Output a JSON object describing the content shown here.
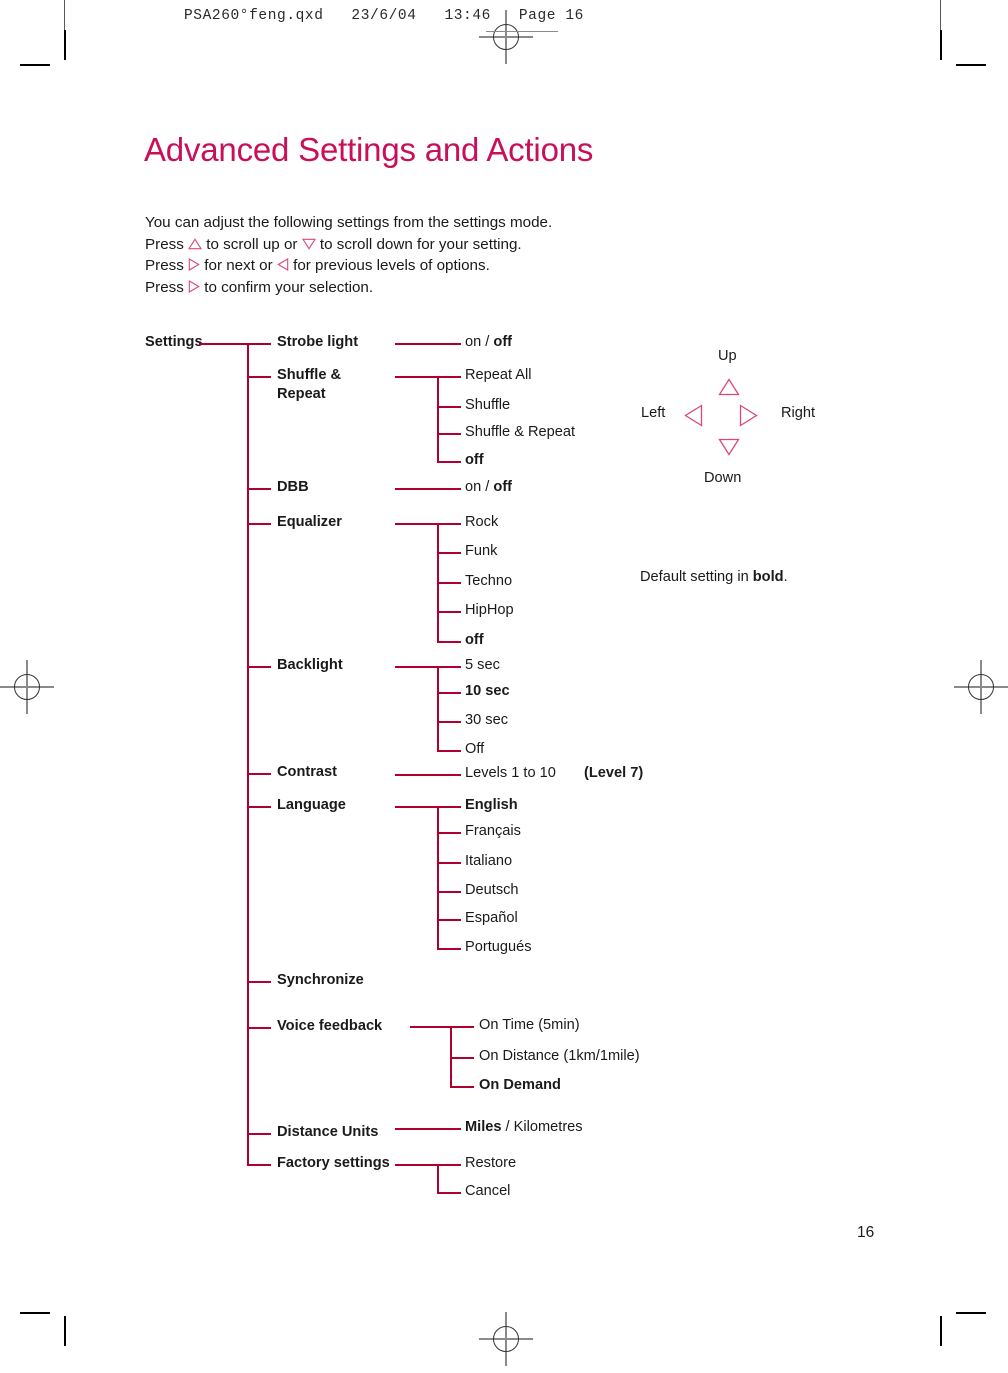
{
  "slug": {
    "text": "PSA260°feng.qxd   23/6/04   13:46   Page 16"
  },
  "page": {
    "title": "Advanced Settings and Actions",
    "number": "16",
    "accent_title_color": "#C8105A",
    "accent_line_color": "#B00030"
  },
  "intro": {
    "line1": "You can adjust the following settings from the settings mode.",
    "line2_a": "Press ",
    "line2_b": " to scroll up or ",
    "line2_c": " to scroll down for your setting.",
    "line3_a": "Press ",
    "line3_b": " for next or ",
    "line3_c": " for previous levels of options.",
    "line4_a": "Press ",
    "line4_b": " to confirm your selection."
  },
  "tree": {
    "root": "Settings",
    "branches": [
      {
        "label": "Strobe light",
        "bold": true,
        "options": [
          {
            "text": "on / ",
            "bold": false,
            "suffix": "off",
            "suffix_bold": true
          }
        ]
      },
      {
        "label": "Shuffle &",
        "label2": "Repeat",
        "bold": true,
        "options": [
          {
            "text": "Repeat All",
            "bold": false
          },
          {
            "text": "Shuffle",
            "bold": false
          },
          {
            "text": "Shuffle & Repeat",
            "bold": false
          },
          {
            "text": "off",
            "bold": true
          }
        ]
      },
      {
        "label": "DBB",
        "bold": true,
        "options": [
          {
            "text": "on / ",
            "bold": false,
            "suffix": "off",
            "suffix_bold": true
          }
        ]
      },
      {
        "label": "Equalizer",
        "bold": true,
        "options": [
          {
            "text": "Rock",
            "bold": false
          },
          {
            "text": "Funk",
            "bold": false
          },
          {
            "text": "Techno",
            "bold": false
          },
          {
            "text": "HipHop",
            "bold": false
          },
          {
            "text": "off",
            "bold": true
          }
        ]
      },
      {
        "label": "Backlight",
        "bold": true,
        "options": [
          {
            "text": "5 sec",
            "bold": false
          },
          {
            "text": "10 sec",
            "bold": true
          },
          {
            "text": "30 sec",
            "bold": false
          },
          {
            "text": "Off",
            "bold": false
          }
        ]
      },
      {
        "label": "Contrast",
        "bold": true,
        "options": [
          {
            "text": "Levels 1 to 10",
            "bold": false,
            "note": "(Level 7)"
          }
        ]
      },
      {
        "label": "Language",
        "bold": true,
        "options": [
          {
            "text": "English",
            "bold": true
          },
          {
            "text": "Français",
            "bold": false
          },
          {
            "text": "Italiano",
            "bold": false
          },
          {
            "text": "Deutsch",
            "bold": false
          },
          {
            "text": "Español",
            "bold": false
          },
          {
            "text": "Portugués",
            "bold": false
          }
        ]
      },
      {
        "label": "Synchronize",
        "bold": true,
        "options": []
      },
      {
        "label": "Voice feedback",
        "bold": true,
        "options": [
          {
            "text": "On Time (5min)",
            "bold": false
          },
          {
            "text": "On Distance (1km/1mile)",
            "bold": false
          },
          {
            "text": "On Demand",
            "bold": true
          }
        ]
      },
      {
        "label": "Distance Units",
        "bold": true,
        "options": [
          {
            "text": "Miles",
            "bold": true,
            "suffix": " / Kilometres",
            "suffix_bold": false
          }
        ]
      },
      {
        "label": "Factory settings",
        "bold": true,
        "options": [
          {
            "text": "Restore",
            "bold": false
          },
          {
            "text": "Cancel",
            "bold": false
          }
        ]
      }
    ]
  },
  "nav_diagram": {
    "up": "Up",
    "down": "Down",
    "left": "Left",
    "right": "Right"
  },
  "legend": {
    "prefix": "Default setting in ",
    "bold_word": "bold",
    "suffix": "."
  }
}
